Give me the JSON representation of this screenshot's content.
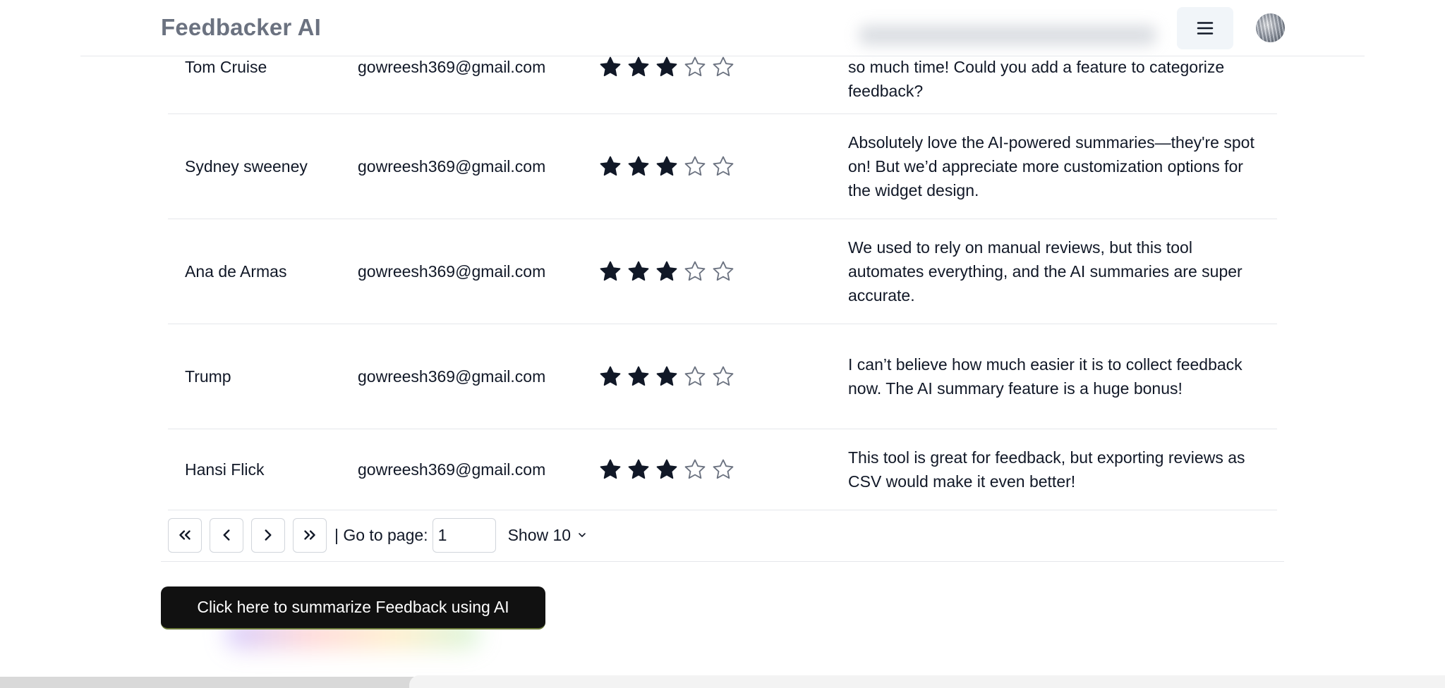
{
  "header": {
    "brand": "Feedbacker AI",
    "menu_icon": "hamburger-icon",
    "avatar_icon": "user-avatar"
  },
  "table": {
    "rows": [
      {
        "name": "Tom Cruise",
        "email": "gowreesh369@gmail.com",
        "rating": 3,
        "max_rating": 5,
        "comment": "so much time! Could you add a feature to categorize feedback?"
      },
      {
        "name": "Sydney sweeney",
        "email": "gowreesh369@gmail.com",
        "rating": 3,
        "max_rating": 5,
        "comment": "Absolutely love the AI-powered summaries—they're spot on! But we’d appreciate more customization options for the widget design."
      },
      {
        "name": "Ana de Armas",
        "email": "gowreesh369@gmail.com",
        "rating": 3,
        "max_rating": 5,
        "comment": "We used to rely on manual reviews, but this tool automates everything, and the AI summaries are super accurate."
      },
      {
        "name": "Trump",
        "email": "gowreesh369@gmail.com",
        "rating": 3,
        "max_rating": 5,
        "comment": "I can’t believe how much easier it is to collect feedback now. The AI summary feature is a huge bonus!"
      },
      {
        "name": "Hansi Flick",
        "email": "gowreesh369@gmail.com",
        "rating": 3,
        "max_rating": 5,
        "comment": "This tool is great for feedback, but exporting reviews as CSV would make it even better!"
      }
    ]
  },
  "pagination": {
    "first_icon": "chevrons-left-icon",
    "prev_icon": "chevron-left-icon",
    "next_icon": "chevron-right-icon",
    "last_icon": "chevrons-right-icon",
    "goto_label": "| Go to page:",
    "page_value": "1",
    "show_label": "Show 10"
  },
  "cta": {
    "label": "Click here to summarize Feedback using AI"
  },
  "colors": {
    "star_filled": "#111827",
    "star_empty_stroke": "#6b7280",
    "cta_bg": "#111111",
    "brand_text": "#6b7280"
  }
}
